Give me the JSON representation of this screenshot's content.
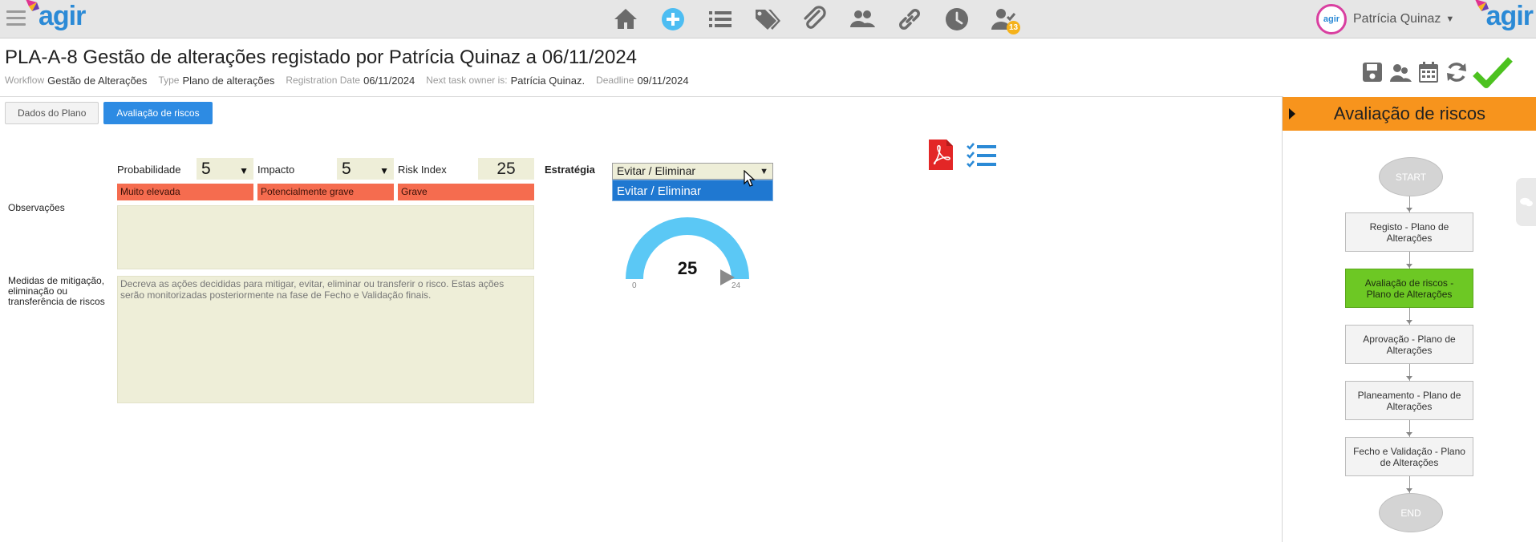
{
  "app": {
    "logo_text": "agir",
    "avatar_text": "agir"
  },
  "nav": {
    "icons": [
      "home-icon",
      "add-circle-icon",
      "list-icon",
      "tags-icon",
      "paperclip-icon",
      "users-icon",
      "link-icon",
      "clock-icon",
      "user-check-icon"
    ],
    "badge_count": "13"
  },
  "user": {
    "name": "Patrícia Quinaz"
  },
  "header": {
    "title": "PLA-A-8 Gestão de alterações registado por Patrícia Quinaz a 06/11/2024",
    "meta": {
      "workflow_label": "Workflow",
      "workflow_value": "Gestão de Alterações",
      "type_label": "Type",
      "type_value": "Plano de alterações",
      "regdate_label": "Registration Date",
      "regdate_value": "06/11/2024",
      "owner_label": "Next task owner is:",
      "owner_value": "Patrícia Quinaz.",
      "deadline_label": "Deadline",
      "deadline_value": "09/11/2024"
    },
    "actions": [
      "save-icon",
      "users-group-icon",
      "calendar-icon",
      "refresh-icon",
      "checkmark-icon"
    ]
  },
  "tabs": [
    {
      "label": "Dados do Plano",
      "active": false
    },
    {
      "label": "Avaliação de riscos",
      "active": true
    }
  ],
  "form": {
    "probabilidade_label": "Probabilidade",
    "probabilidade_value": "5",
    "probabilidade_tag": "Muito elevada",
    "impacto_label": "Impacto",
    "impacto_value": "5",
    "impacto_tag": "Potencialmente grave",
    "risk_index_label": "Risk Index",
    "risk_index_value": "25",
    "risk_index_tag": "Grave",
    "estrategia_label": "Estratégia",
    "estrategia_value": "Evitar / Eliminar",
    "estrategia_options": [
      "Evitar / Eliminar"
    ],
    "observacoes_label": "Observações",
    "medidas_label": "Medidas de mitigação, eliminação ou transferência de riscos",
    "medidas_placeholder": "Decreva as ações decididas para mitigar, evitar, eliminar ou transferir o risco. Estas ações serão monitorizadas posteriormente na fase de Fecho e Validação finais.",
    "tag_color": "#f56c4f"
  },
  "gauge": {
    "value": "25",
    "min": "0",
    "max": "24",
    "color": "#5bc8f5"
  },
  "workflow_panel": {
    "title": "Avaliação de riscos",
    "header_color": "#f7941d",
    "start_label": "START",
    "end_label": "END",
    "nodes": [
      {
        "label": "Registo - Plano de Alterações",
        "active": false
      },
      {
        "label": "Avaliação de riscos - Plano de Alterações",
        "active": true
      },
      {
        "label": "Aprovação - Plano de Alterações",
        "active": false
      },
      {
        "label": "Planeamento - Plano de Alterações",
        "active": false
      },
      {
        "label": "Fecho e Validação - Plano de Alterações",
        "active": false
      }
    ]
  }
}
